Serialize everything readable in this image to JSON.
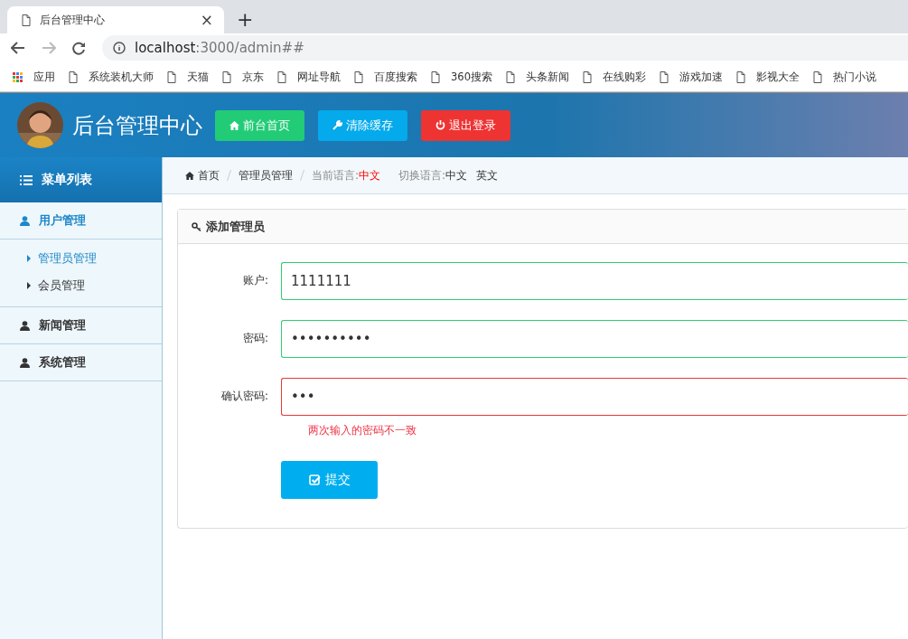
{
  "browser": {
    "tab_title": "后台管理中心",
    "close": "×",
    "new_tab": "+",
    "url_host": "localhost",
    "url_path": ":3000/admin##",
    "bookmarks": [
      {
        "label": "应用",
        "kind": "apps"
      },
      {
        "label": "系统装机大师",
        "kind": "page"
      },
      {
        "label": "天猫",
        "kind": "page"
      },
      {
        "label": "京东",
        "kind": "page"
      },
      {
        "label": "网址导航",
        "kind": "page"
      },
      {
        "label": "百度搜索",
        "kind": "page"
      },
      {
        "label": "360搜索",
        "kind": "page"
      },
      {
        "label": "头条新闻",
        "kind": "page"
      },
      {
        "label": "在线购彩",
        "kind": "page"
      },
      {
        "label": "游戏加速",
        "kind": "page"
      },
      {
        "label": "影视大全",
        "kind": "page"
      },
      {
        "label": "热门小说",
        "kind": "page"
      }
    ]
  },
  "header": {
    "title": "后台管理中心",
    "buttons": [
      {
        "label": "前台首页",
        "kind": "home",
        "color": "#22cc77"
      },
      {
        "label": "清除缓存",
        "kind": "wrench",
        "color": "#04aaeb"
      },
      {
        "label": "退出登录",
        "kind": "power",
        "color": "#ee3333"
      }
    ]
  },
  "sidebar": {
    "title": "菜单列表",
    "groups": [
      {
        "label": "用户管理",
        "expanded": true,
        "children": [
          {
            "label": "管理员管理",
            "selected": true
          },
          {
            "label": "会员管理",
            "selected": false
          }
        ]
      },
      {
        "label": "新闻管理",
        "expanded": false
      },
      {
        "label": "系统管理",
        "expanded": false
      }
    ]
  },
  "breadcrumb": {
    "items": [
      "首页",
      "管理员管理"
    ],
    "current_language_label": "当前语言:",
    "current_language": "中文",
    "switch_label": "切换语言:",
    "languages": [
      "中文",
      "英文"
    ]
  },
  "form": {
    "title": "添加管理员",
    "fields": [
      {
        "label": "账户:",
        "value": "1111111",
        "valid": true
      },
      {
        "label": "密码:",
        "value": "••••••••••",
        "valid": true
      },
      {
        "label": "确认密码:",
        "value": "•••",
        "valid": false,
        "error": "两次输入的密码不一致"
      }
    ],
    "submit": "提交"
  }
}
